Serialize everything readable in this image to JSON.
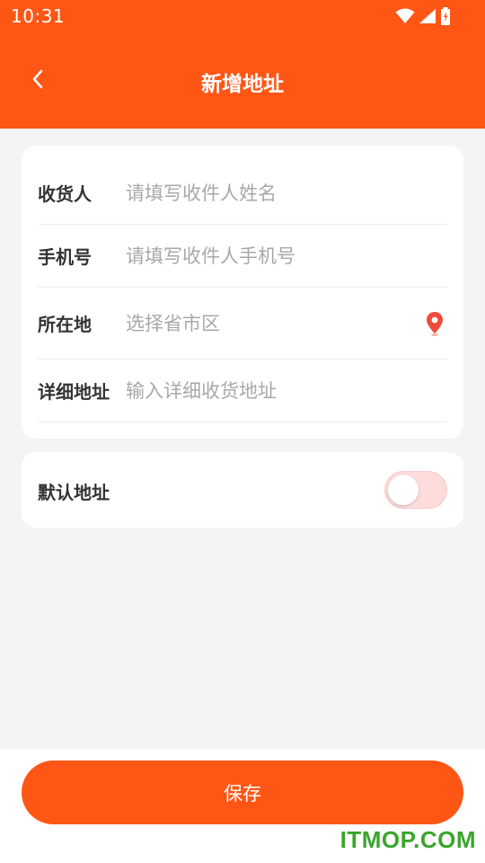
{
  "status_bar": {
    "time": "10:31"
  },
  "header": {
    "title": "新增地址"
  },
  "form": {
    "rows": [
      {
        "label": "收货人",
        "placeholder": "请填写收件人姓名",
        "value": ""
      },
      {
        "label": "手机号",
        "placeholder": "请填写收件人手机号",
        "value": ""
      },
      {
        "label": "所在地",
        "placeholder": "选择省市区",
        "value": ""
      },
      {
        "label": "详细地址",
        "placeholder": "输入详细收货地址",
        "value": ""
      }
    ]
  },
  "default_address": {
    "label": "默认地址",
    "enabled": false
  },
  "footer": {
    "save_label": "保存"
  },
  "watermark": "ITMOP.COM",
  "colors": {
    "primary": "#ff5615",
    "location_pin": "#f04a3a",
    "toggle_off_track": "#ffdcdc",
    "watermark": "#3aa62c"
  },
  "icons": [
    "back-arrow-icon",
    "wifi-icon",
    "signal-icon",
    "battery-icon",
    "location-pin-icon"
  ]
}
